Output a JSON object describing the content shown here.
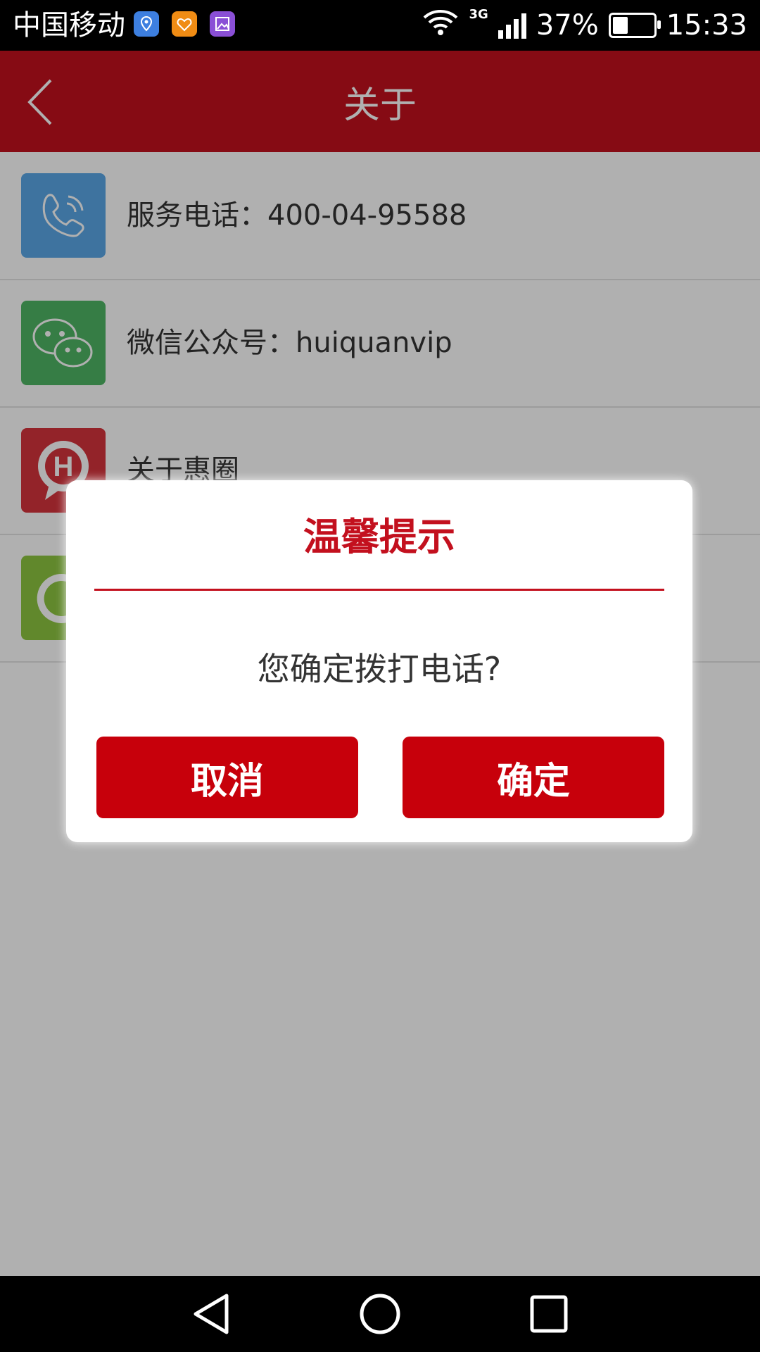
{
  "status_bar": {
    "carrier": "中国移动",
    "network": "3G",
    "battery": "37%",
    "battery_level": 0.37,
    "time": "15:33",
    "app_icons": [
      "location-app-icon",
      "heart-app-icon",
      "gallery-app-icon"
    ]
  },
  "header": {
    "title": "关于",
    "back_icon": "chevron-left-icon"
  },
  "list": {
    "items": [
      {
        "icon": "phone-icon",
        "icon_color": "#5aa7e6",
        "label": "服务电话：400-04-95588"
      },
      {
        "icon": "wechat-icon",
        "icon_color": "#4fb565",
        "label": "微信公众号：huiquanvip"
      },
      {
        "icon": "huiquan-logo-icon",
        "icon_color": "#d6343c",
        "label": "关于惠圈"
      },
      {
        "icon": "refresh-icon",
        "icon_color": "#8dc540",
        "label": ""
      }
    ]
  },
  "dialog": {
    "title": "温馨提示",
    "message": "您确定拨打电话?",
    "cancel_label": "取消",
    "confirm_label": "确定"
  },
  "colors": {
    "brand": "#c3101e",
    "button": "#c7000b"
  },
  "nav_bar": {
    "icons": [
      "nav-back-icon",
      "nav-home-icon",
      "nav-recents-icon"
    ]
  }
}
